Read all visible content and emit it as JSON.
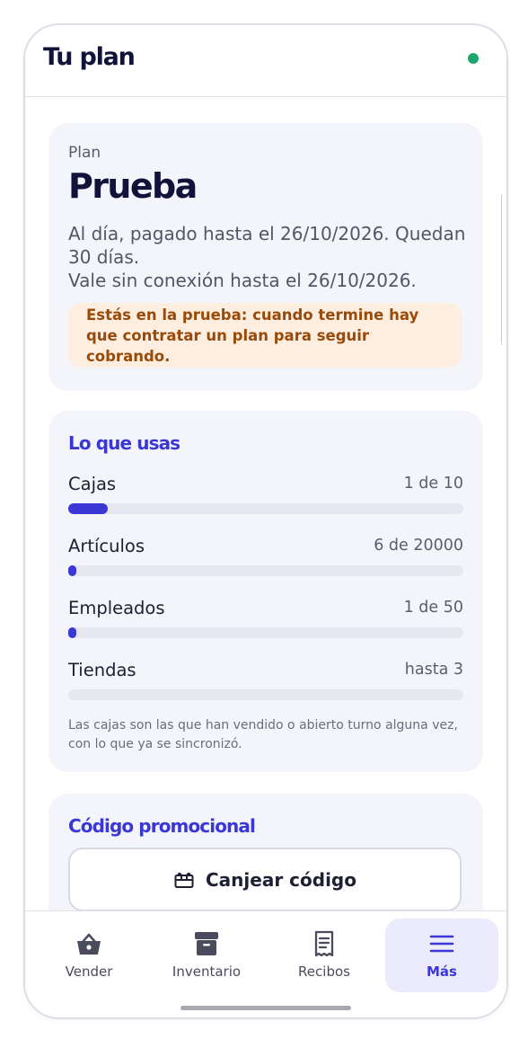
{
  "header": {
    "title": "Tu plan",
    "status_color": "#1aa86c"
  },
  "plan": {
    "label": "Plan",
    "name": "Prueba",
    "status_line1": "Al día, pagado hasta el 26/10/2026. Quedan 30 días.",
    "status_line2": "Vale sin conexión hasta el 26/10/2026.",
    "notice": "Estás en la prueba: cuando termine hay que contratar un plan para seguir cobrando."
  },
  "usage": {
    "title": "Lo que usas",
    "items": [
      {
        "name": "Cajas",
        "value": "1 de 10",
        "fraction": 0.1
      },
      {
        "name": "Artículos",
        "value": "6 de 20000",
        "fraction": 0.0003
      },
      {
        "name": "Empleados",
        "value": "1 de 50",
        "fraction": 0.02
      },
      {
        "name": "Tiendas",
        "value": "hasta 3",
        "fraction": 0
      }
    ],
    "note": "Las cajas son las que han vendido o abierto turno alguna vez, con lo que ya se sincronizó."
  },
  "promo": {
    "title": "Código promocional",
    "button_label": "Canjear código",
    "button_icon": "gift-icon"
  },
  "nav": {
    "items": [
      {
        "label": "Vender",
        "icon": "basket-icon"
      },
      {
        "label": "Inventario",
        "icon": "archive-box-icon"
      },
      {
        "label": "Recibos",
        "icon": "receipt-icon"
      },
      {
        "label": "Más",
        "icon": "menu-icon",
        "active": true
      }
    ]
  },
  "colors": {
    "accent": "#3a37d6",
    "notice_bg": "#fdeee0",
    "notice_text": "#9a4a08"
  }
}
